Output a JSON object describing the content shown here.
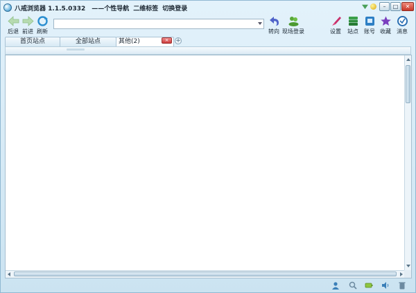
{
  "window": {
    "title": "八戒浏览器 1.1.5.0332",
    "title_links": [
      "——个性导航",
      "二维标签",
      "切换登录"
    ],
    "controls": [
      "下拉",
      "皮肤",
      "最小化",
      "最大化",
      "关闭"
    ]
  },
  "toolbar": {
    "back_label": "后退",
    "forward_label": "前进",
    "refresh_label": "刷新",
    "address_value": "",
    "goto_label": "转向",
    "scene_login_label": "现场登录",
    "settings_label": "设置",
    "sites_label": "站点",
    "account_label": "账号",
    "favorites_label": "收藏",
    "messages_label": "消息"
  },
  "tabs": [
    {
      "label": "首页站点"
    },
    {
      "label": "全部站点"
    },
    {
      "label": "其他(2)"
    }
  ],
  "tab_close_label": "×",
  "tab_add_label": "+",
  "colors": {
    "chrome": "#cbe3f1",
    "accent": "#2e7fb5",
    "close_red": "#cc3b3b"
  },
  "statusbar_icons": [
    "user-icon",
    "search-icon",
    "battery-icon",
    "volume-icon",
    "trash-icon"
  ]
}
